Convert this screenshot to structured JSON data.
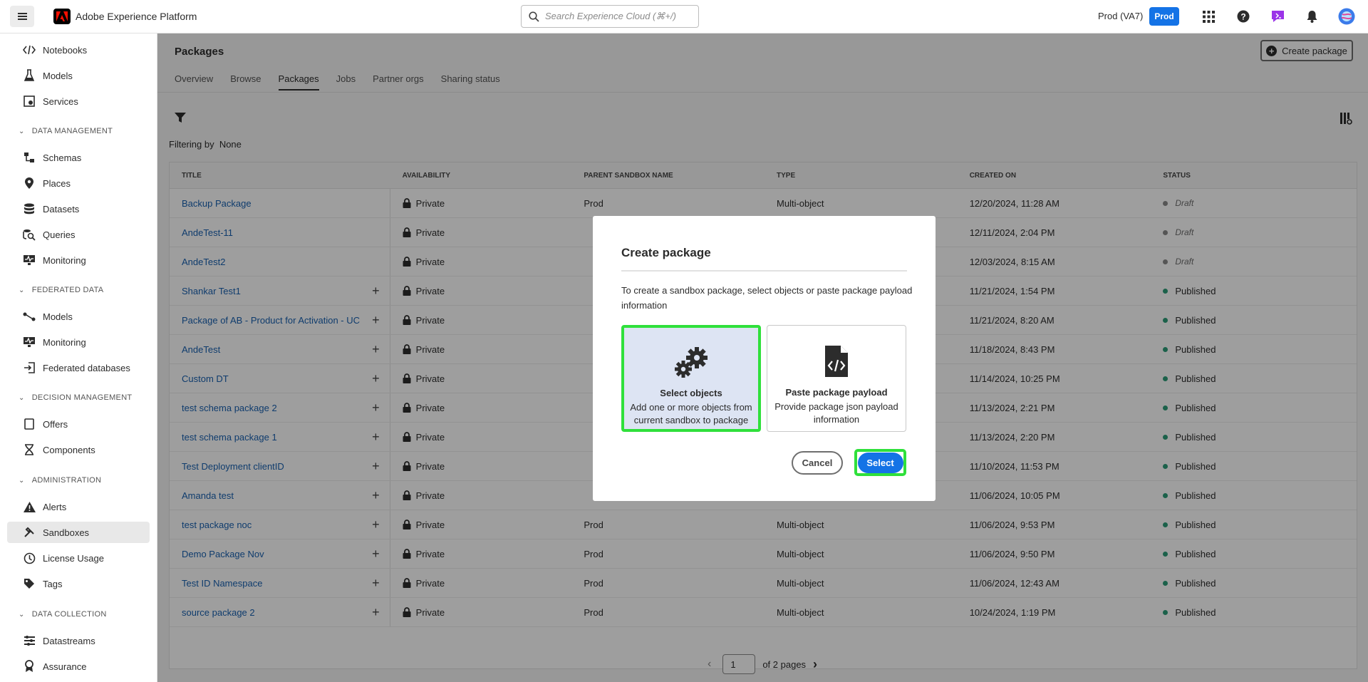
{
  "app": {
    "title": "Adobe Experience Platform",
    "search_placeholder": "Search Experience Cloud (⌘+/)",
    "env_label": "Prod (VA7)",
    "env_badge": "Prod"
  },
  "sidebar": {
    "items": [
      {
        "label": "Notebooks"
      },
      {
        "label": "Models"
      },
      {
        "label": "Services"
      },
      {
        "label": "Schemas"
      },
      {
        "label": "Places"
      },
      {
        "label": "Datasets"
      },
      {
        "label": "Queries"
      },
      {
        "label": "Monitoring"
      },
      {
        "label": "Models"
      },
      {
        "label": "Monitoring"
      },
      {
        "label": "Federated databases"
      },
      {
        "label": "Offers"
      },
      {
        "label": "Components"
      },
      {
        "label": "Alerts"
      },
      {
        "label": "Sandboxes"
      },
      {
        "label": "License Usage"
      },
      {
        "label": "Tags"
      },
      {
        "label": "Datastreams"
      },
      {
        "label": "Assurance"
      }
    ],
    "groups": [
      "DATA MANAGEMENT",
      "FEDERATED DATA",
      "DECISION MANAGEMENT",
      "ADMINISTRATION",
      "DATA COLLECTION"
    ]
  },
  "page": {
    "title": "Packages",
    "create_button": "Create package",
    "tabs": [
      "Overview",
      "Browse",
      "Packages",
      "Jobs",
      "Partner orgs",
      "Sharing status"
    ],
    "filtering_label": "Filtering by",
    "filtering_value": "None"
  },
  "table": {
    "headers": [
      "TITLE",
      "AVAILABILITY",
      "PARENT SANDBOX NAME",
      "TYPE",
      "CREATED ON",
      "STATUS"
    ],
    "rows": [
      {
        "title": "Backup Package",
        "availability": "Private",
        "parent": "Prod",
        "type": "Multi-object",
        "created": "12/20/2024, 11:28 AM",
        "status": "Draft"
      },
      {
        "title": "AndeTest-11",
        "availability": "Private",
        "parent": "",
        "type": "",
        "created": "12/11/2024, 2:04 PM",
        "status": "Draft"
      },
      {
        "title": "AndeTest2",
        "availability": "Private",
        "parent": "",
        "type": "",
        "created": "12/03/2024, 8:15 AM",
        "status": "Draft"
      },
      {
        "title": "Shankar Test1",
        "availability": "Private",
        "parent": "",
        "type": "",
        "created": "11/21/2024, 1:54 PM",
        "status": "Published"
      },
      {
        "title": "Package of AB - Product for Activation - UC",
        "availability": "Private",
        "parent": "",
        "type": "",
        "created": "11/21/2024, 8:20 AM",
        "status": "Published"
      },
      {
        "title": "AndeTest",
        "availability": "Private",
        "parent": "",
        "type": "",
        "created": "11/18/2024, 8:43 PM",
        "status": "Published"
      },
      {
        "title": "Custom DT",
        "availability": "Private",
        "parent": "",
        "type": "",
        "created": "11/14/2024, 10:25 PM",
        "status": "Published"
      },
      {
        "title": "test schema package 2",
        "availability": "Private",
        "parent": "",
        "type": "",
        "created": "11/13/2024, 2:21 PM",
        "status": "Published"
      },
      {
        "title": "test schema package 1",
        "availability": "Private",
        "parent": "",
        "type": "",
        "created": "11/13/2024, 2:20 PM",
        "status": "Published"
      },
      {
        "title": "Test Deployment clientID",
        "availability": "Private",
        "parent": "",
        "type": "",
        "created": "11/10/2024, 11:53 PM",
        "status": "Published"
      },
      {
        "title": "Amanda test",
        "availability": "Private",
        "parent": "",
        "type": "",
        "created": "11/06/2024, 10:05 PM",
        "status": "Published"
      },
      {
        "title": "test package noc",
        "availability": "Private",
        "parent": "Prod",
        "type": "Multi-object",
        "created": "11/06/2024, 9:53 PM",
        "status": "Published"
      },
      {
        "title": "Demo Package Nov",
        "availability": "Private",
        "parent": "Prod",
        "type": "Multi-object",
        "created": "11/06/2024, 9:50 PM",
        "status": "Published"
      },
      {
        "title": "Test ID Namespace",
        "availability": "Private",
        "parent": "Prod",
        "type": "Multi-object",
        "created": "11/06/2024, 12:43 AM",
        "status": "Published"
      },
      {
        "title": "source package 2",
        "availability": "Private",
        "parent": "Prod",
        "type": "Multi-object",
        "created": "10/24/2024, 1:19 PM",
        "status": "Published"
      }
    ]
  },
  "pagination": {
    "page": "1",
    "of_label": "of 2 pages"
  },
  "modal": {
    "title": "Create package",
    "description": "To create a sandbox package, select objects or paste package payload information",
    "card1": {
      "title": "Select objects",
      "desc": "Add one or more objects from current sandbox to package"
    },
    "card2": {
      "title": "Paste package payload",
      "desc": "Provide package json payload information"
    },
    "cancel": "Cancel",
    "select": "Select"
  },
  "colors": {
    "accent": "#1473e6",
    "draft": "#8a8a8a",
    "published": "#2d9d78",
    "highlight": "#2fe03b"
  }
}
